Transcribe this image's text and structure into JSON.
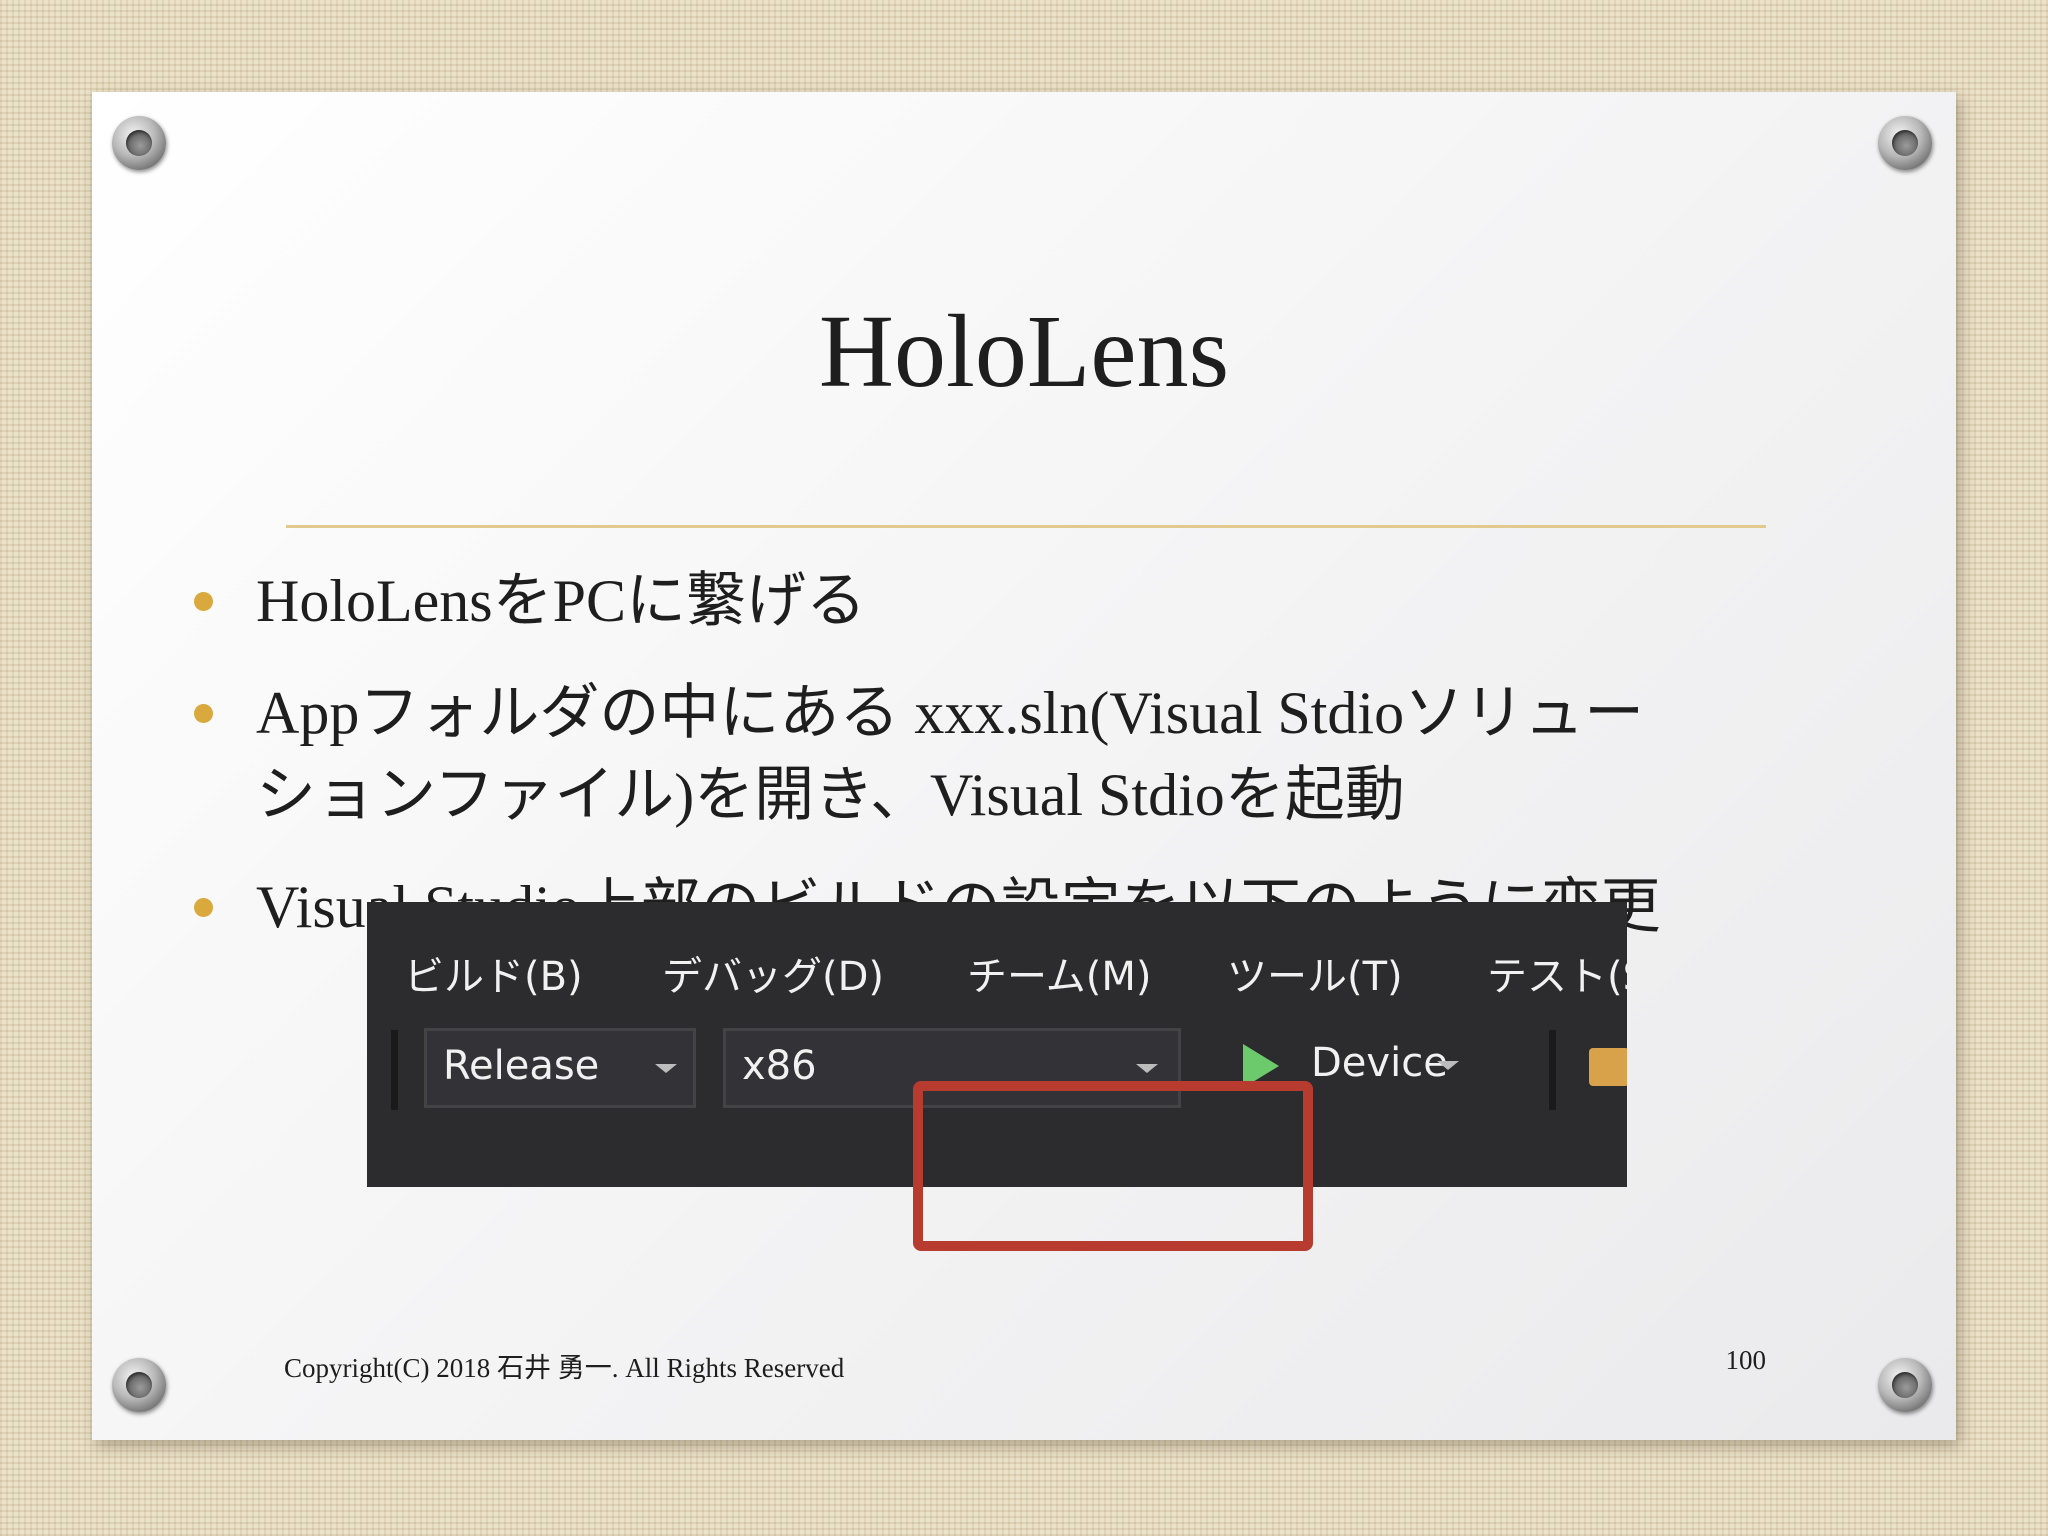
{
  "slide": {
    "title": "HoloLens",
    "bullets": [
      "HoloLensをPCに繋げる",
      "Appフォルダの中にある xxx.sln(Visual Stdioソリュー\nションファイル)を開き、Visual Stdioを起動",
      "Visual Studio上部のビルドの設定を以下のように変更"
    ],
    "footer": {
      "copyright": "Copyright(C) 2018 石井 勇一. All Rights Reserved",
      "page_number": "100"
    }
  },
  "vs_toolbar": {
    "menu": [
      "ビルド(B)",
      "デバッグ(D)",
      "チーム(M)",
      "ツール(T)",
      "テスト(S"
    ],
    "configuration": "Release",
    "platform": "x86",
    "run_target": "Device"
  },
  "colors": {
    "accent_bullet": "#d9a93e",
    "rule": "#e2c98d",
    "highlight_box": "#b83b30",
    "vs_background": "#2c2c2e",
    "play_icon": "#6cc96c"
  }
}
